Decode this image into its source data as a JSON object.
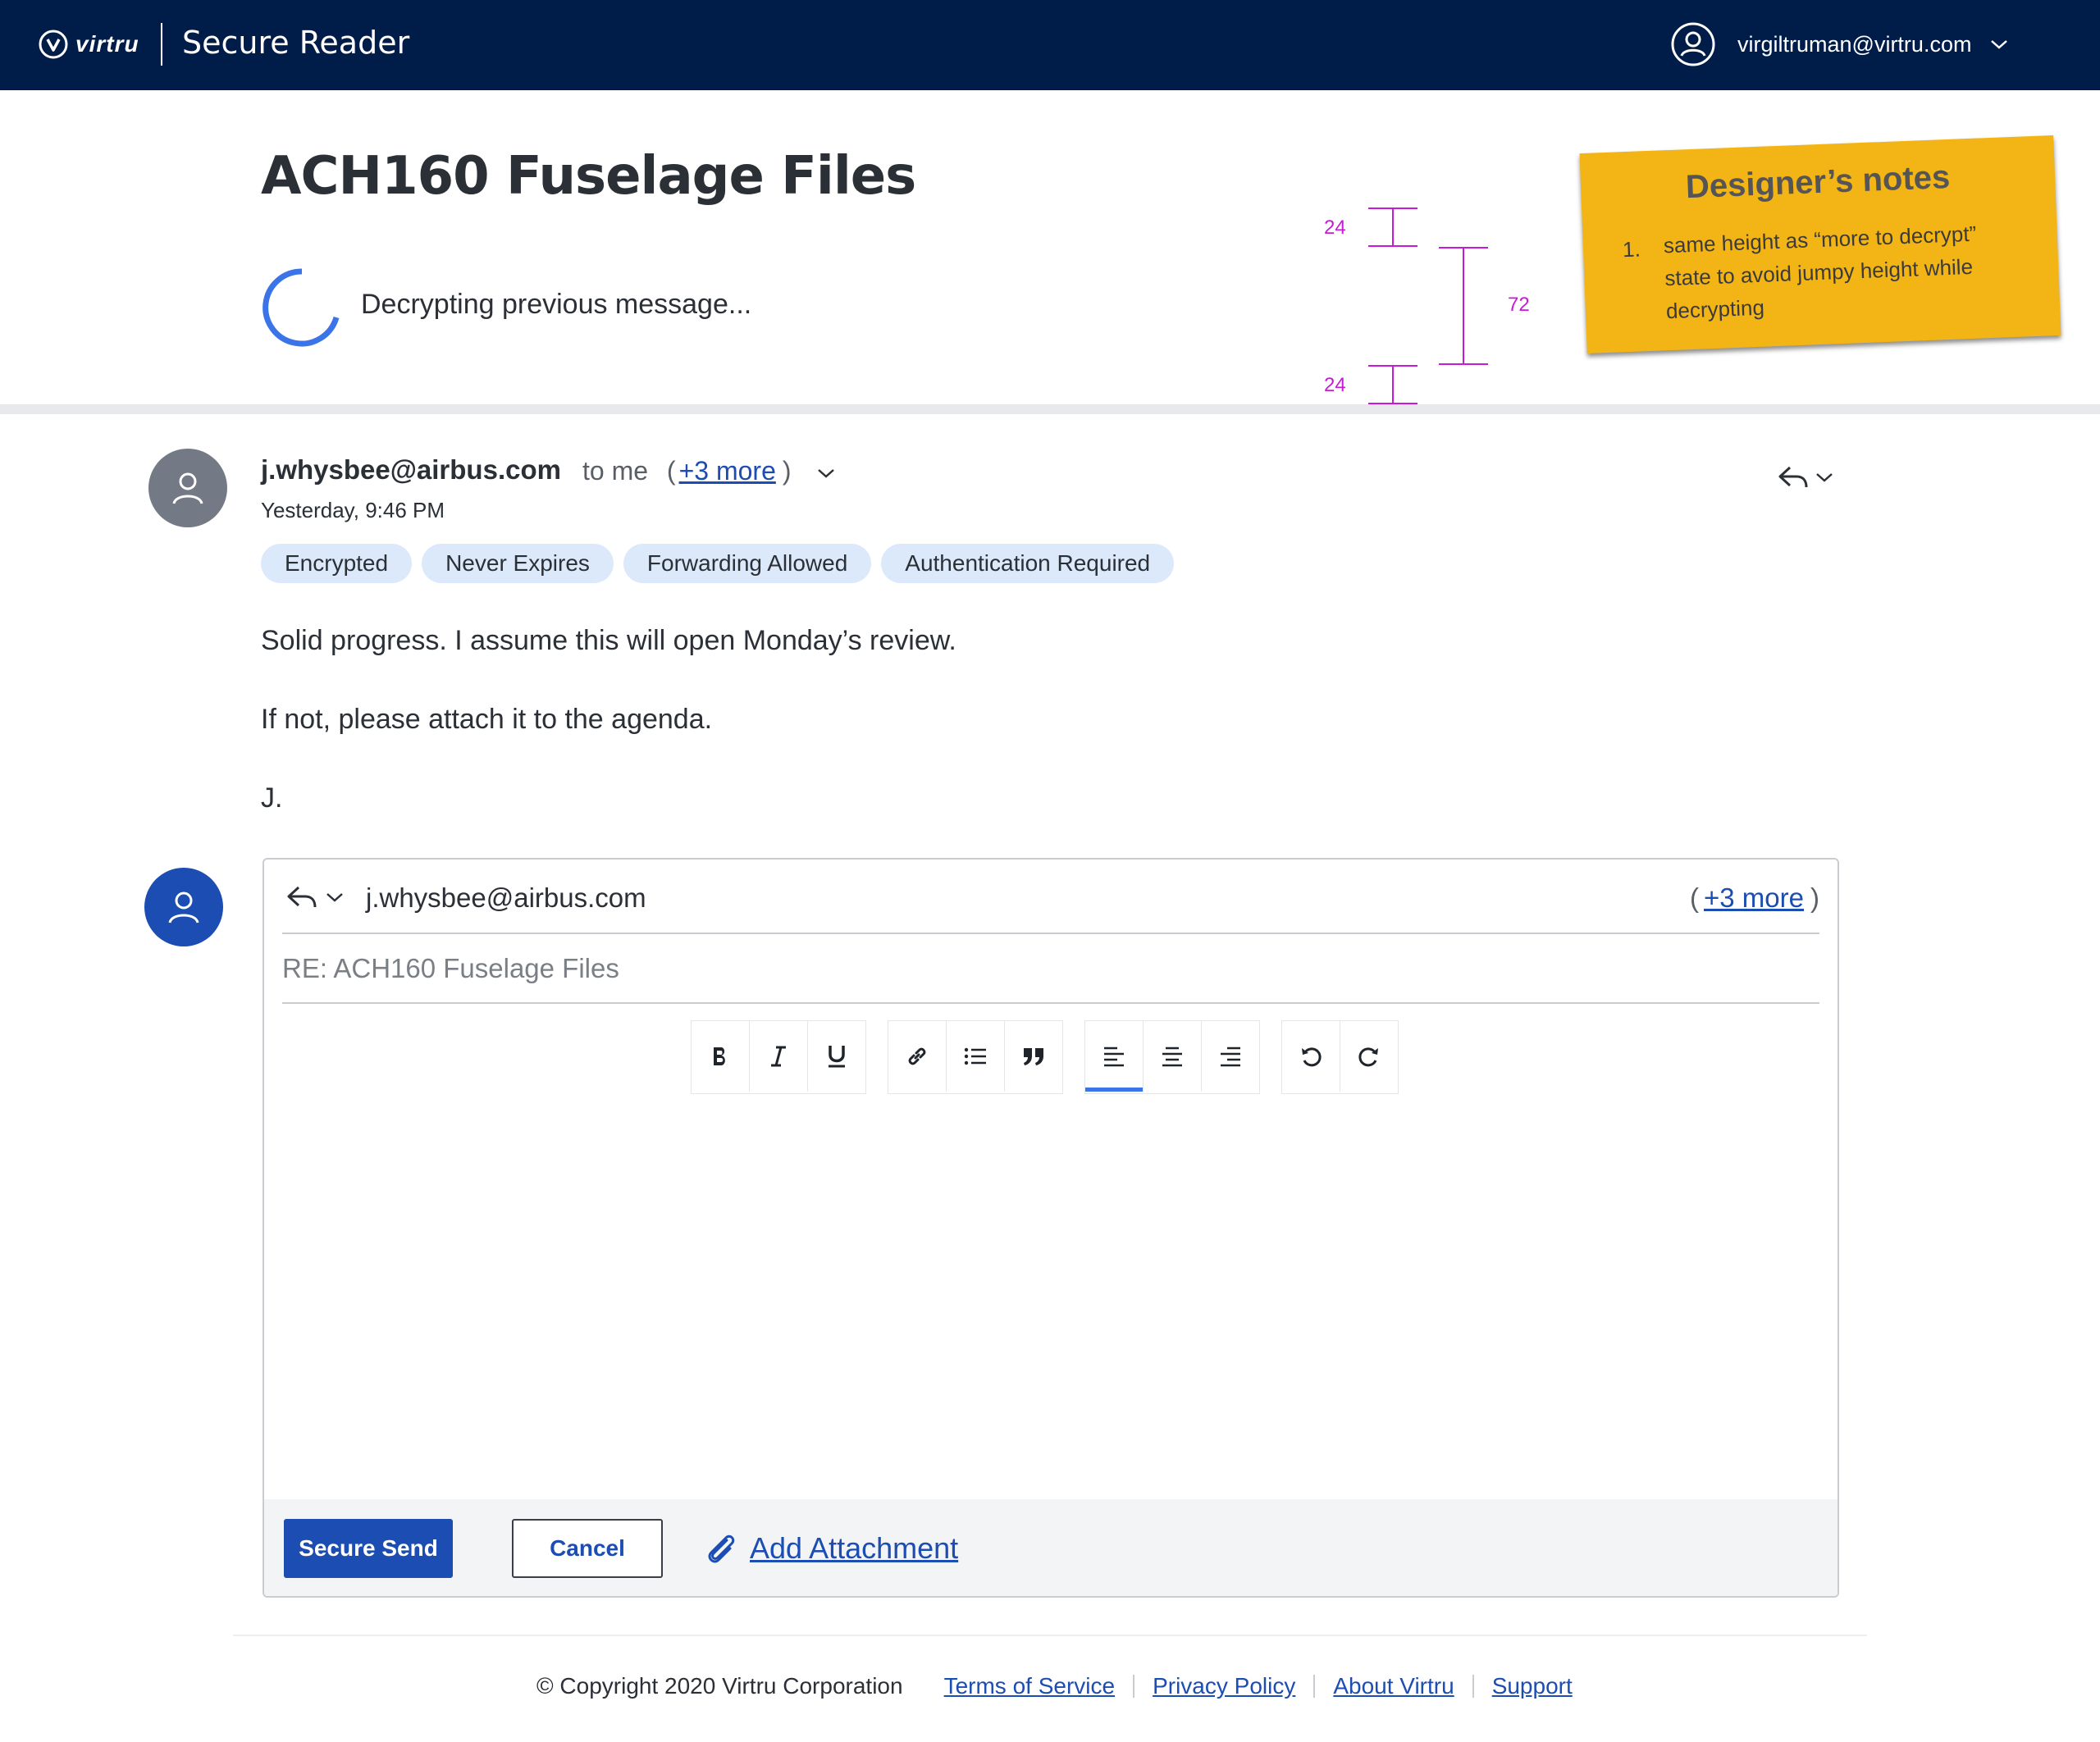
{
  "app": {
    "logo_text": "virtru",
    "title": "Secure Reader",
    "user_email": "virgiltruman@virtru.com"
  },
  "message_header": {
    "subject": "ACH160 Fuselage Files",
    "decrypt_status": "Decrypting previous message..."
  },
  "designer_notes": {
    "title": "Designer’s notes",
    "items": [
      {
        "number": "1.",
        "text": "same height as “more to decrypt” state to avoid jumpy height while decrypting"
      }
    ],
    "dimension_labels": [
      "24",
      "72",
      "24"
    ]
  },
  "message": {
    "sender": "j.whysbee@airbus.com",
    "to_me": "to me",
    "paren_open": "(",
    "more_recipients": "+3 more",
    "paren_close": ")",
    "timestamp": "Yesterday, 9:46 PM",
    "tags": [
      "Encrypted",
      "Never Expires",
      "Forwarding Allowed",
      "Authentication Required"
    ],
    "body": [
      "Solid progress. I assume this will open Monday’s review.",
      "If not, please attach it to the agenda.",
      "J."
    ]
  },
  "compose": {
    "to": "j.whysbee@airbus.com",
    "more_recipients": "+3 more",
    "subject": "RE: ACH160 Fuselage Files",
    "toolbar_groups": [
      [
        "bold-icon",
        "italic-icon",
        "underline-icon"
      ],
      [
        "link-icon",
        "bulleted-list-icon",
        "quote-icon"
      ],
      [
        "align-left-icon",
        "align-center-icon",
        "align-right-icon"
      ],
      [
        "undo-icon",
        "redo-icon"
      ]
    ],
    "active_alignment": "align-left",
    "send_label": "Secure Send",
    "cancel_label": "Cancel",
    "attach_label": "Add Attachment"
  },
  "footer": {
    "copyright": "© Copyright 2020 Virtru Corporation",
    "links": [
      "Terms of Service",
      "Privacy Policy",
      "About Virtru",
      "Support"
    ]
  },
  "colors": {
    "topbar": "#001d4a",
    "primary": "#1b4db3",
    "tag_bg": "#dce9fb",
    "note_bg": "#f3b416",
    "dimension": "#c81ad6",
    "spinner": "#3a74e8"
  }
}
